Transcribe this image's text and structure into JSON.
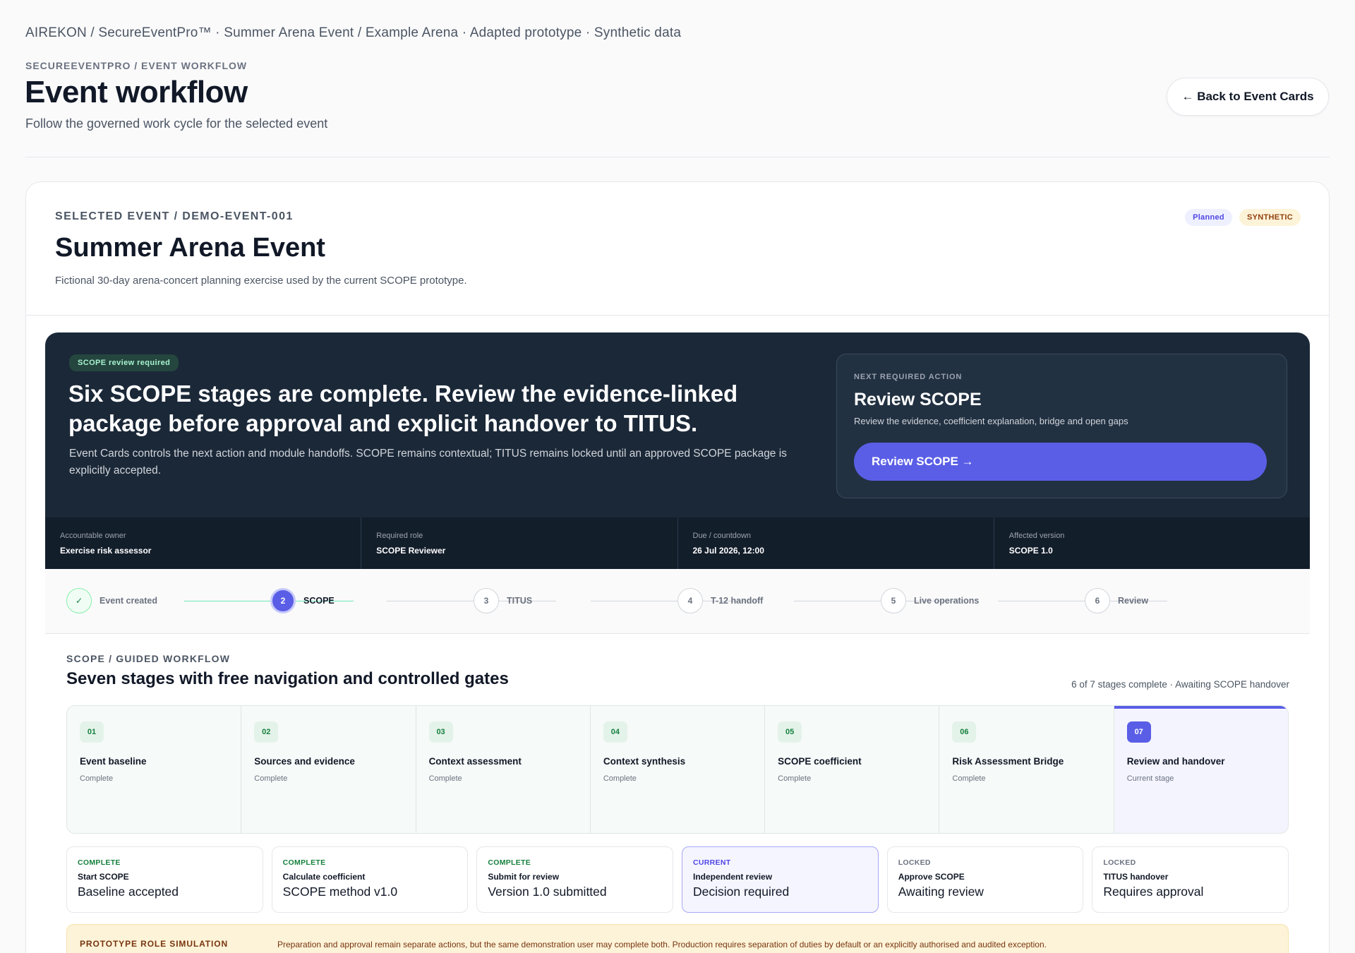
{
  "breadcrumb": "AIREKON / SecureEventPro™ · Summer Arena Event / Example Arena · Adapted prototype · Synthetic data",
  "header": {
    "eyebrow": "SECUREEVENTPRO / EVENT WORKFLOW",
    "title": "Event workflow",
    "subtitle": "Follow the governed work cycle for the selected event",
    "back_button": "← Back to Event Cards"
  },
  "event": {
    "eyebrow": "SELECTED EVENT / DEMO-EVENT-001",
    "name": "Summer Arena Event",
    "description": "Fictional 30-day arena-concert planning exercise used by the current SCOPE prototype.",
    "badges": {
      "status": "Planned",
      "data": "SYNTHETIC"
    }
  },
  "hero": {
    "chip": "SCOPE review required",
    "title": "Six SCOPE stages are complete. Review the evidence-linked package before approval and explicit handover to TITUS.",
    "text": "Event Cards controls the next action and module handoffs. SCOPE remains contextual; TITUS remains locked until an approved SCOPE package is explicitly accepted.",
    "next_action": {
      "eyebrow": "NEXT REQUIRED ACTION",
      "title": "Review SCOPE",
      "description": "Review the evidence, coefficient explanation, bridge and open gaps",
      "button": "Review SCOPE →"
    },
    "meta": [
      {
        "label": "Accountable owner",
        "value": "Exercise risk assessor"
      },
      {
        "label": "Required role",
        "value": "SCOPE Reviewer"
      },
      {
        "label": "Due / countdown",
        "value": "26 Jul 2026, 12:00"
      },
      {
        "label": "Affected version",
        "value": "SCOPE 1.0"
      }
    ]
  },
  "module_steps": [
    {
      "marker": "✓",
      "label": "Event created",
      "state": "done"
    },
    {
      "marker": "2",
      "label": "SCOPE",
      "state": "active"
    },
    {
      "marker": "3",
      "label": "TITUS",
      "state": "pending"
    },
    {
      "marker": "4",
      "label": "T-12 handoff",
      "state": "pending"
    },
    {
      "marker": "5",
      "label": "Live operations",
      "state": "pending"
    },
    {
      "marker": "6",
      "label": "Review",
      "state": "pending"
    }
  ],
  "guided": {
    "eyebrow": "SCOPE / GUIDED WORKFLOW",
    "title": "Seven stages with free navigation and controlled gates",
    "status": "6 of 7 stages complete · Awaiting SCOPE handover",
    "stages": [
      {
        "num": "01",
        "name": "Event baseline",
        "status": "Complete"
      },
      {
        "num": "02",
        "name": "Sources and evidence",
        "status": "Complete"
      },
      {
        "num": "03",
        "name": "Context assessment",
        "status": "Complete"
      },
      {
        "num": "04",
        "name": "Context synthesis",
        "status": "Complete"
      },
      {
        "num": "05",
        "name": "SCOPE coefficient",
        "status": "Complete"
      },
      {
        "num": "06",
        "name": "Risk Assessment Bridge",
        "status": "Complete"
      },
      {
        "num": "07",
        "name": "Review and handover",
        "status": "Current stage"
      }
    ],
    "gates": [
      {
        "state": "COMPLETE",
        "name": "Start SCOPE",
        "value": "Baseline accepted"
      },
      {
        "state": "COMPLETE",
        "name": "Calculate coefficient",
        "value": "SCOPE method v1.0"
      },
      {
        "state": "COMPLETE",
        "name": "Submit for review",
        "value": "Version 1.0 submitted"
      },
      {
        "state": "CURRENT",
        "name": "Independent review",
        "value": "Decision required"
      },
      {
        "state": "LOCKED",
        "name": "Approve SCOPE",
        "value": "Awaiting review"
      },
      {
        "state": "LOCKED",
        "name": "TITUS handover",
        "value": "Requires approval"
      }
    ]
  },
  "prototype_notice": {
    "label": "PROTOTYPE ROLE SIMULATION",
    "text": "Preparation and approval remain separate actions, but the same demonstration user may complete both. Production requires separation of duties by default or an explicitly authorised and audited exception."
  },
  "colors": {
    "accent": "#5a5ee6",
    "dark_panel": "#1b2838",
    "complete": "#15803d",
    "warning_bg": "#fdf3d8"
  }
}
